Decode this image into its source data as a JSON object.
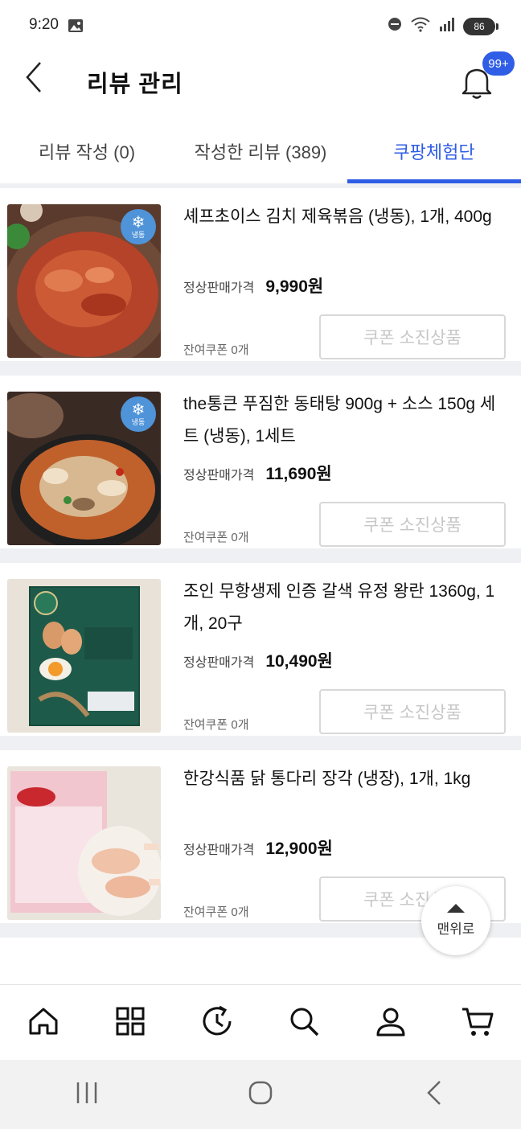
{
  "status_bar": {
    "time": "9:20",
    "battery": "86"
  },
  "header": {
    "title": "리뷰 관리",
    "notification_badge": "99+"
  },
  "tabs": [
    {
      "label": "리뷰 작성 (0)"
    },
    {
      "label": "작성한 리뷰 (389)"
    },
    {
      "label": "쿠팡체험단"
    }
  ],
  "items": [
    {
      "name": "셰프초이스 김치 제육볶음 (냉동), 1개, 400g",
      "price_label": "정상판매가격",
      "price": "9,990원",
      "coupon_remaining": "잔여쿠폰 0개",
      "button_label": "쿠폰 소진상품",
      "badge": "냉동"
    },
    {
      "name": "the통큰 푸짐한 동태탕 900g + 소스 150g 세트 (냉동), 1세트",
      "price_label": "정상판매가격",
      "price": "11,690원",
      "coupon_remaining": "잔여쿠폰 0개",
      "button_label": "쿠폰 소진상품",
      "badge": "냉동"
    },
    {
      "name": "조인 무항생제 인증 갈색 유정 왕란 1360g, 1개, 20구",
      "price_label": "정상판매가격",
      "price": "10,490원",
      "coupon_remaining": "잔여쿠폰 0개",
      "button_label": "쿠폰 소진상품"
    },
    {
      "name": "한강식품 닭 통다리 장각 (냉장), 1개, 1kg",
      "price_label": "정상판매가격",
      "price": "12,900원",
      "coupon_remaining": "잔여쿠폰 0개",
      "button_label": "쿠폰 소진상품"
    }
  ],
  "top_button": {
    "label": "맨위로"
  },
  "bottom_nav": [
    {
      "icon": "home-icon"
    },
    {
      "icon": "category-grid-icon"
    },
    {
      "icon": "recent-history-icon"
    },
    {
      "icon": "search-icon"
    },
    {
      "icon": "my-account-icon"
    },
    {
      "icon": "cart-icon"
    }
  ],
  "colors": {
    "accent": "#2f5de6",
    "freeze_badge": "#4f93d8",
    "divider": "#eef0f3"
  }
}
